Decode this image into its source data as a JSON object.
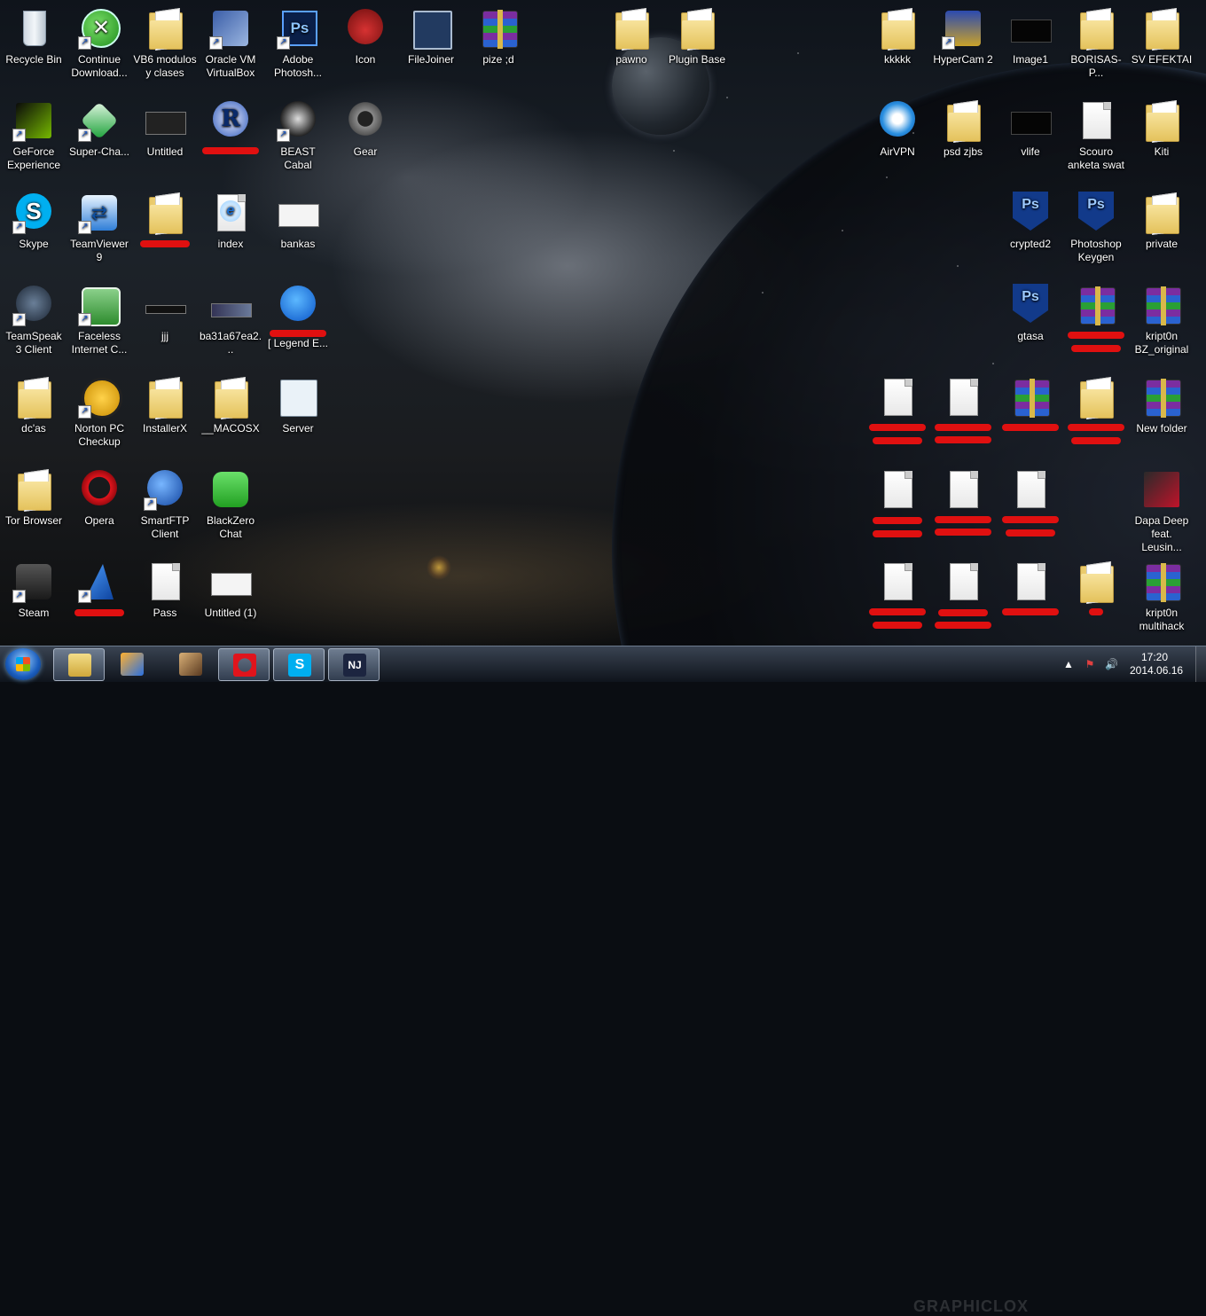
{
  "desktop": {
    "icons": [
      {
        "label": "Recycle Bin"
      },
      {
        "label": "Continue Download..."
      },
      {
        "label": "VB6 modulos y clases"
      },
      {
        "label": "Oracle VM VirtualBox"
      },
      {
        "label": "Adobe Photosh..."
      },
      {
        "label": "Icon"
      },
      {
        "label": "FileJoiner"
      },
      {
        "label": "pize ;d"
      },
      {
        "label": "pawno"
      },
      {
        "label": "Plugin Base"
      },
      {
        "label": "kkkkk"
      },
      {
        "label": "HyperCam 2"
      },
      {
        "label": "Image1"
      },
      {
        "label": "BORISAS-P..."
      },
      {
        "label": "SV EFEKTAI"
      },
      {
        "label": "GeForce Experience"
      },
      {
        "label": "Super-Cha..."
      },
      {
        "label": "Untitled"
      },
      {
        "label": "BEAST Cabal"
      },
      {
        "label": "Gear"
      },
      {
        "label": "AirVPN"
      },
      {
        "label": "psd zjbs"
      },
      {
        "label": "vlife"
      },
      {
        "label": "Scouro anketa swat"
      },
      {
        "label": "Kiti"
      },
      {
        "label": "Skype"
      },
      {
        "label": "TeamViewer 9"
      },
      {
        "label": "index"
      },
      {
        "label": "bankas"
      },
      {
        "label": "crypted2"
      },
      {
        "label": "Photoshop Keygen"
      },
      {
        "label": "private"
      },
      {
        "label": "TeamSpeak 3 Client"
      },
      {
        "label": "Faceless Internet C..."
      },
      {
        "label": "jjj"
      },
      {
        "label": "ba31a67ea2..."
      },
      {
        "label": "[ Legend E..."
      },
      {
        "label": "gtasa"
      },
      {
        "label": "kript0n BZ_original"
      },
      {
        "label": "dc'as"
      },
      {
        "label": "Norton PC Checkup"
      },
      {
        "label": "InstallerX"
      },
      {
        "label": "__MACOSX"
      },
      {
        "label": "Server"
      },
      {
        "label": "New folder"
      },
      {
        "label": "Tor Browser"
      },
      {
        "label": "Opera"
      },
      {
        "label": "SmartFTP Client"
      },
      {
        "label": "BlackZero Chat"
      },
      {
        "label": "Dapa Deep feat. Leusin..."
      },
      {
        "label": "Steam"
      },
      {
        "label": "Pass"
      },
      {
        "label": "Untitled (1)"
      },
      {
        "label": "kript0n multihack"
      }
    ]
  },
  "taskbar": {
    "clock_time": "17:20",
    "clock_date": "2014.06.16",
    "skype_glyph": "S",
    "nj_glyph": "NJ"
  },
  "watermark": "GRAPHICLOX",
  "colors": {
    "taskbar": "#1a222c",
    "redaction": "#e01010",
    "label_text": "#ffffff"
  }
}
